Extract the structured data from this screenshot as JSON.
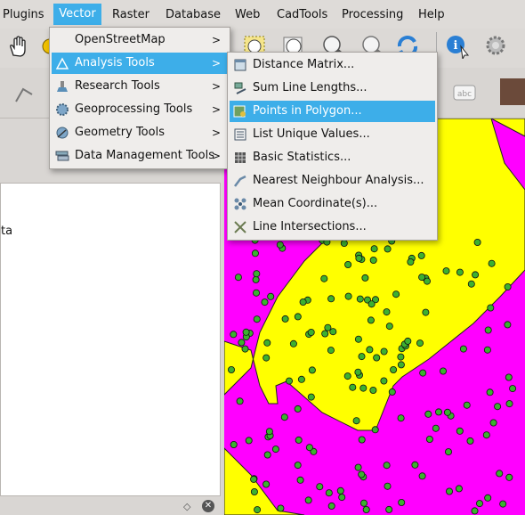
{
  "menubar": {
    "items": [
      {
        "label": "Plugins"
      },
      {
        "label": "Vector",
        "active": true
      },
      {
        "label": "Raster"
      },
      {
        "label": "Database"
      },
      {
        "label": "Web"
      },
      {
        "label": "CadTools"
      },
      {
        "label": "Processing"
      },
      {
        "label": "Help"
      }
    ]
  },
  "vector_menu": {
    "items": [
      {
        "label": "OpenStreetMap",
        "icon": "none"
      },
      {
        "label": "Analysis Tools",
        "icon": "analysis-tools-icon",
        "highlighted": true
      },
      {
        "label": "Research Tools",
        "icon": "research-tools-icon"
      },
      {
        "label": "Geoprocessing Tools",
        "icon": "geoprocessing-icon"
      },
      {
        "label": "Geometry Tools",
        "icon": "geometry-tools-icon"
      },
      {
        "label": "Data Management Tools",
        "icon": "data-management-icon"
      }
    ],
    "submenu_arrow": ">"
  },
  "analysis_submenu": {
    "items": [
      {
        "label": "Distance Matrix...",
        "icon": "distance-matrix-icon"
      },
      {
        "label": "Sum Line Lengths...",
        "icon": "sum-line-lengths-icon"
      },
      {
        "label": "Points in Polygon...",
        "icon": "points-in-polygon-icon",
        "highlighted": true
      },
      {
        "label": "List Unique Values...",
        "icon": "list-unique-values-icon"
      },
      {
        "label": "Basic Statistics...",
        "icon": "basic-statistics-icon"
      },
      {
        "label": "Nearest Neighbour Analysis...",
        "icon": "nearest-neighbour-icon"
      },
      {
        "label": "Mean Coordinate(s)...",
        "icon": "mean-coordinates-icon"
      },
      {
        "label": "Line Intersections...",
        "icon": "line-intersections-icon"
      }
    ]
  },
  "left_panel": {
    "partial_text": "ta"
  },
  "colors": {
    "highlight": "#3daee9",
    "polygon_magenta": "#ff00ff",
    "polygon_yellow": "#ffff00",
    "point_green": "#3cb030"
  }
}
